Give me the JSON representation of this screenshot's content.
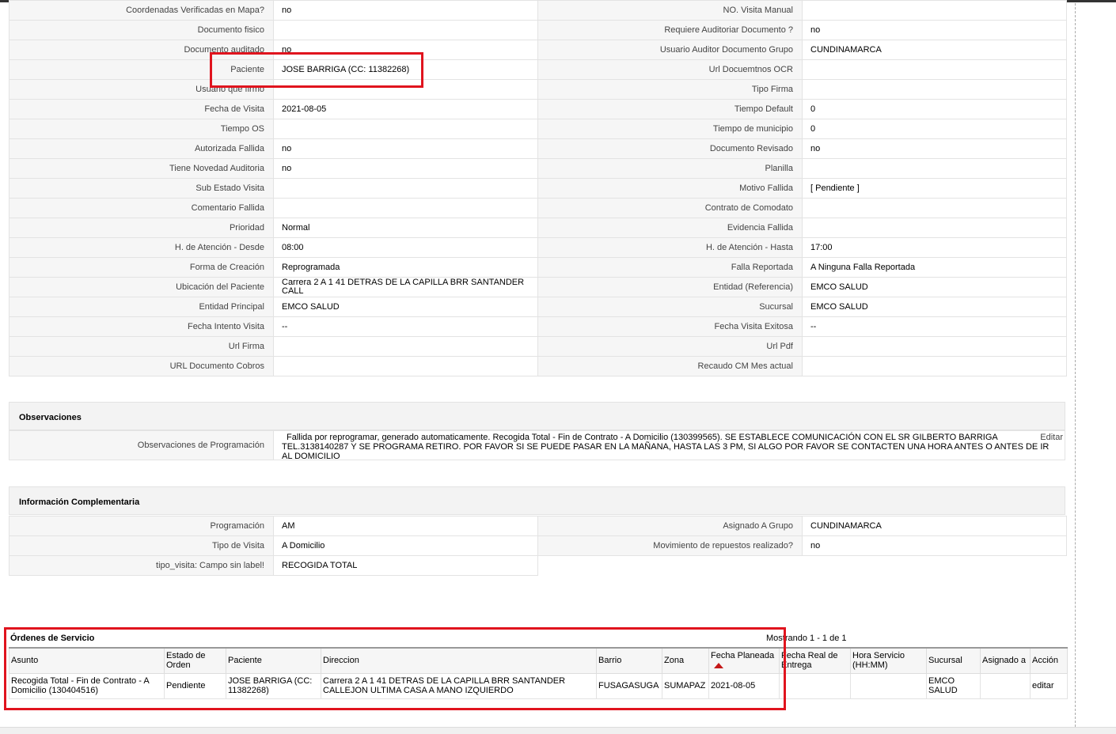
{
  "details": {
    "rows": [
      {
        "l1": "Coordenadas Verificadas en Mapa?",
        "v1": "no",
        "l2": "NO. Visita Manual",
        "v2": ""
      },
      {
        "l1": "Documento fisico",
        "v1": "",
        "l2": "Requiere Auditoriar Documento ?",
        "v2": "no"
      },
      {
        "l1": "Documento auditado",
        "v1": "no",
        "l2": "Usuario Auditor Documento Grupo",
        "v2": "CUNDINAMARCA"
      },
      {
        "l1": "Paciente",
        "v1": "JOSE BARRIGA (CC: 11382268)",
        "l2": "Url Docuemtnos OCR",
        "v2": ""
      },
      {
        "l1": "Usuario que firmo",
        "v1": "",
        "l2": "Tipo Firma",
        "v2": ""
      },
      {
        "l1": "Fecha de Visita",
        "v1": "2021-08-05",
        "l2": "Tiempo Default",
        "v2": "0"
      },
      {
        "l1": "Tiempo OS",
        "v1": "",
        "l2": "Tiempo de municipio",
        "v2": "0"
      },
      {
        "l1": "Autorizada Fallida",
        "v1": "no",
        "l2": "Documento Revisado",
        "v2": "no"
      },
      {
        "l1": "Tiene Novedad Auditoria",
        "v1": "no",
        "l2": "Planilla",
        "v2": ""
      },
      {
        "l1": "Sub Estado Visita",
        "v1": "",
        "l2": "Motivo Fallida",
        "v2": "[ Pendiente ]"
      },
      {
        "l1": "Comentario Fallida",
        "v1": "",
        "l2": "Contrato de Comodato",
        "v2": ""
      },
      {
        "l1": "Prioridad",
        "v1": "Normal",
        "l2": "Evidencia Fallida",
        "v2": ""
      },
      {
        "l1": "H. de Atención - Desde",
        "v1": "08:00",
        "l2": "H. de Atención - Hasta",
        "v2": "17:00"
      },
      {
        "l1": "Forma de Creación",
        "v1": "Reprogramada",
        "l2": "Falla Reportada",
        "v2": "A Ninguna Falla Reportada"
      },
      {
        "l1": "Ubicación del Paciente",
        "v1": "Carrera 2 A 1 41 DETRAS DE LA CAPILLA BRR SANTANDER CALL",
        "l2": "Entidad (Referencia)",
        "v2": "EMCO SALUD"
      },
      {
        "l1": "Entidad Principal",
        "v1": "EMCO SALUD",
        "l2": "Sucursal",
        "v2": "EMCO SALUD"
      },
      {
        "l1": "Fecha Intento Visita",
        "v1": "--",
        "l2": "Fecha Visita Exitosa",
        "v2": "--"
      },
      {
        "l1": "Url Firma",
        "v1": "",
        "l2": "Url Pdf",
        "v2": ""
      },
      {
        "l1": "URL Documento Cobros",
        "v1": "",
        "l2": "Recaudo CM Mes actual",
        "v2": ""
      }
    ]
  },
  "observaciones": {
    "title": "Observaciones",
    "label": "Observaciones de Programación",
    "text": "Fallida por reprogramar, generado automaticamente. Recogida Total - Fin de Contrato - A Domicilio (130399565). SE ESTABLECE COMUNICACIÓN CON EL SR GILBERTO BARRIGA TEL.3138140287 Y SE PROGRAMA RETIRO. POR FAVOR SI SE PUEDE PASAR EN LA MAÑANA, HASTA LAS 3 PM, SI ALGO POR FAVOR SE CONTACTEN UNA HORA ANTES O ANTES DE IR AL DOMICILIO",
    "edit_label": "Editar"
  },
  "complementaria": {
    "title": "Información Complementaria",
    "rows": [
      {
        "l1": "Programación",
        "v1": "AM",
        "l2": "Asignado A Grupo",
        "v2": "CUNDINAMARCA"
      },
      {
        "l1": "Tipo de Visita",
        "v1": "A Domicilio",
        "l2": "Movimiento de repuestos realizado?",
        "v2": "no"
      },
      {
        "l1": "tipo_visita: Campo sin label!",
        "v1": "RECOGIDA TOTAL"
      }
    ]
  },
  "ordenes": {
    "title": "Órdenes de Servicio",
    "count": "Mostrando 1 - 1 de 1",
    "columns": [
      "Asunto",
      "Estado de Orden",
      "Paciente",
      "Direccion",
      "Barrio",
      "Zona",
      "Fecha Planeada",
      "Fecha Real de Entrega",
      "Hora Servicio (HH:MM)",
      "Sucursal",
      "Asignado a",
      "Acción"
    ],
    "rows": [
      [
        "Recogida Total - Fin de Contrato - A Domicilio (130404516)",
        "Pendiente",
        "JOSE BARRIGA (CC: 11382268)",
        "Carrera 2 A 1 41 DETRAS DE LA CAPILLA BRR SANTANDER CALLEJON ULTIMA CASA A MANO IZQUIERDO",
        "FUSAGASUGA",
        "SUMAPAZ",
        "2021-08-05",
        "",
        "",
        "EMCO SALUD",
        "",
        "editar"
      ]
    ]
  },
  "colors": {
    "highlight": "#e0141e",
    "sort_arrow": "#c41818"
  }
}
